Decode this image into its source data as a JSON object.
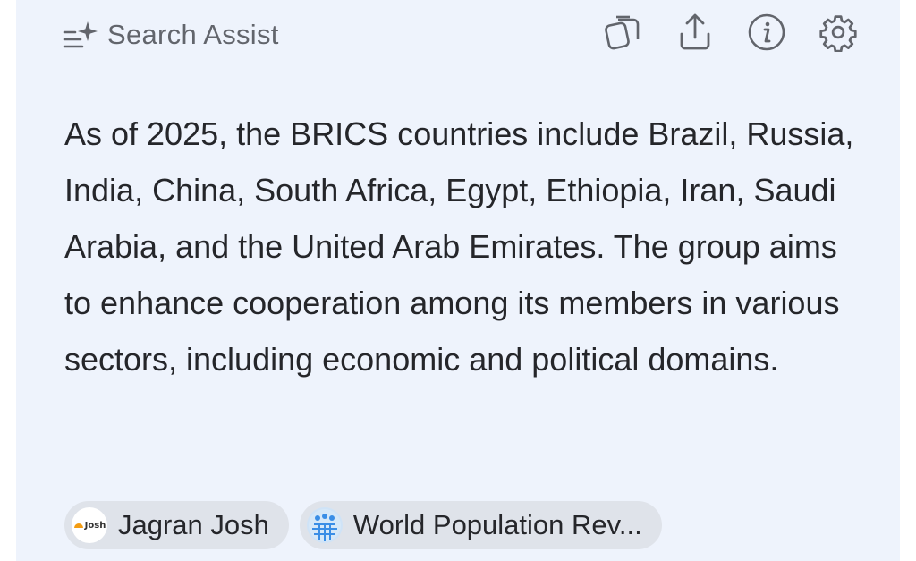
{
  "header": {
    "title": "Search Assist",
    "icons": [
      "search-assist-icon",
      "copy-icon",
      "share-icon",
      "info-icon",
      "gear-icon"
    ]
  },
  "answer": {
    "text": "As of 2025, the BRICS countries include Brazil, Russia, India, China, South Africa, Egypt, Ethiopia, Iran, Saudi Arabia, and the United Arab Emirates. The group aims to enhance cooperation among its members in various sectors, including economic and political domains."
  },
  "sources": [
    {
      "label": "Jagran Josh",
      "favicon_text": "Josh",
      "icon": "jagran-josh-favicon"
    },
    {
      "label": "World Population Rev...",
      "icon": "world-population-review-favicon"
    }
  ],
  "colors": {
    "panel_bg": "#eef3fc",
    "chip_bg": "#dfe3ea",
    "text": "#25262a",
    "muted": "#62656c"
  }
}
